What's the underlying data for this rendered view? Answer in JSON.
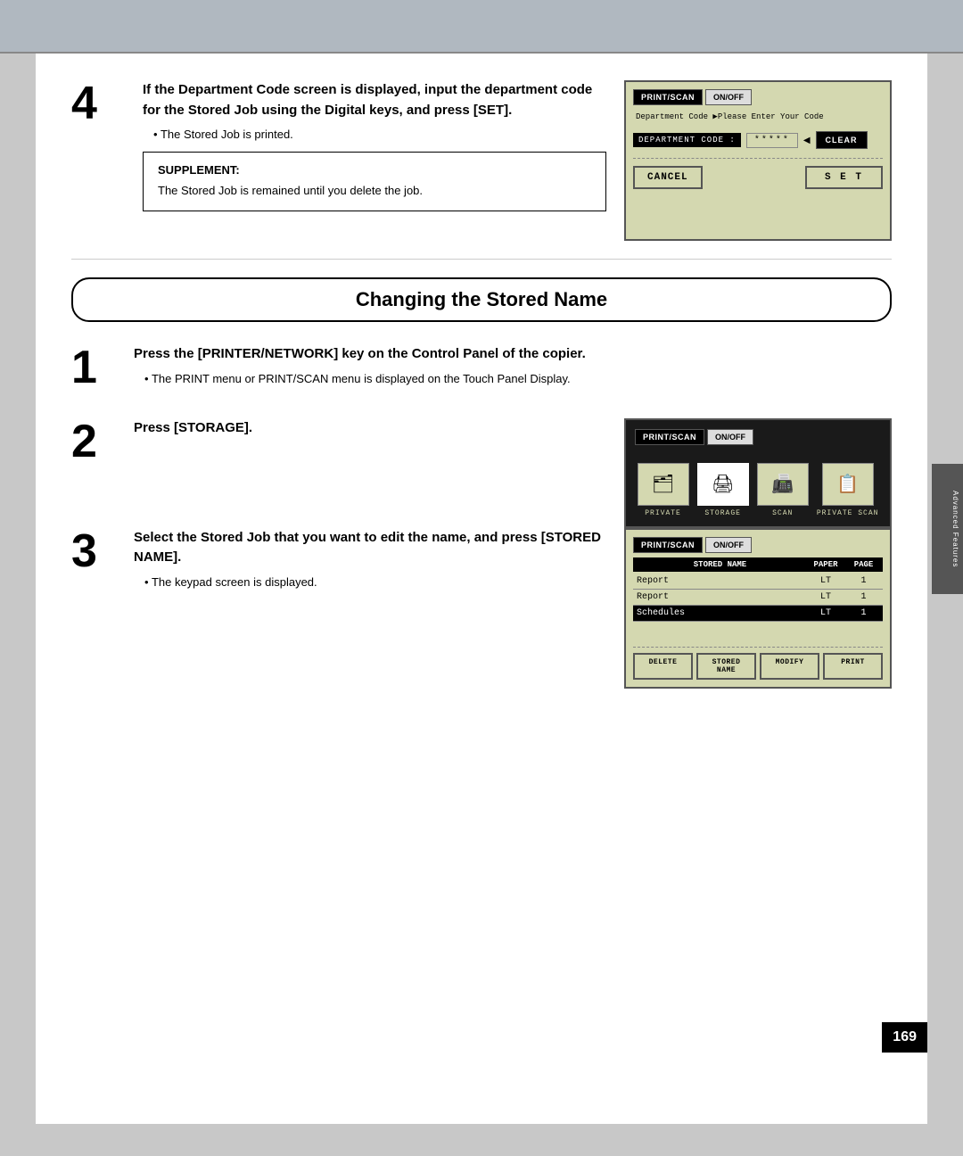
{
  "page": {
    "page_number": "169",
    "side_tab": "Advanced Features"
  },
  "step4": {
    "number": "4",
    "title": "If the Department Code screen is displayed, input the department code for the Stored Job using the Digital keys, and press [SET].",
    "bullet": "The Stored Job is printed.",
    "supplement": {
      "title": "SUPPLEMENT:",
      "text": "The Stored Job is remained until you delete the job."
    },
    "screen": {
      "btn_print_scan": "PRINT/SCAN",
      "btn_on_off": "ON/OFF",
      "dept_line": "Department Code ▶Please Enter Your Code",
      "dept_label": "DEPARTMENT CODE :",
      "stars": "*****",
      "arrow": "◀",
      "clear_btn": "CLEAR",
      "cancel_btn": "CANCEL",
      "set_btn": "S E T"
    }
  },
  "section_header": {
    "title": "Changing the Stored Name"
  },
  "step1": {
    "number": "1",
    "title": "Press the [PRINTER/NETWORK] key on the Control Panel of the copier.",
    "bullet": "The PRINT menu or PRINT/SCAN menu is displayed on the Touch Panel Display."
  },
  "step2": {
    "number": "2",
    "title": "Press [STORAGE].",
    "screen": {
      "btn_print_scan": "PRINT/SCAN",
      "btn_on_off": "ON/OFF",
      "icons": [
        {
          "label": "PRIVATE",
          "symbol": "🗂"
        },
        {
          "label": "STORAGE",
          "symbol": "🖨"
        },
        {
          "label": "SCAN",
          "symbol": "📠"
        },
        {
          "label": "PRIVATE SCAN",
          "symbol": "📋"
        }
      ]
    }
  },
  "step3": {
    "number": "3",
    "title": "Select the Stored Job that you want to edit the name, and press [STORED NAME].",
    "bullet": "The keypad screen is displayed.",
    "screen": {
      "btn_print_scan": "PRINT/SCAN",
      "btn_on_off": "ON/OFF",
      "table_headers": {
        "name": "STORED NAME",
        "paper": "PAPER",
        "page": "PAGE"
      },
      "rows": [
        {
          "name": "Report",
          "paper": "LT",
          "page": "1",
          "selected": false
        },
        {
          "name": "Report",
          "paper": "LT",
          "page": "1",
          "selected": false
        },
        {
          "name": "Schedules",
          "paper": "LT",
          "page": "1",
          "selected": true
        }
      ],
      "buttons": [
        {
          "label": "DELETE",
          "active": false
        },
        {
          "label": "STORED NAME",
          "active": false
        },
        {
          "label": "MODIFY",
          "active": false
        },
        {
          "label": "PRINT",
          "active": false
        }
      ]
    }
  }
}
